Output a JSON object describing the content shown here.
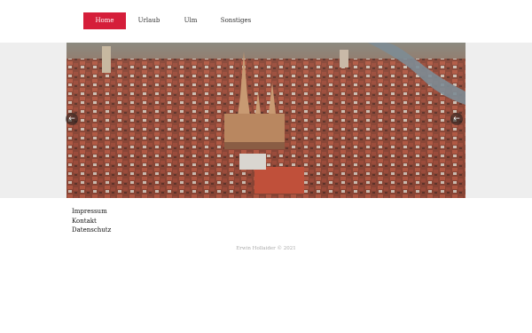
{
  "nav": {
    "items": [
      {
        "label": "Home"
      },
      {
        "label": "Urlaub"
      },
      {
        "label": "Ulm"
      },
      {
        "label": "Sonstiges"
      }
    ],
    "active_color": "#d51e3a"
  },
  "slider": {
    "prev_icon": "arrow-left-icon",
    "next_icon": "arrow-right-icon",
    "prev_glyph": "←",
    "next_glyph": "←"
  },
  "footer": {
    "links": [
      {
        "label": "Impressum"
      },
      {
        "label": "Kontakt"
      },
      {
        "label": "Datenschutz"
      }
    ],
    "copyright": "Erwin Hollaider © 2021"
  }
}
